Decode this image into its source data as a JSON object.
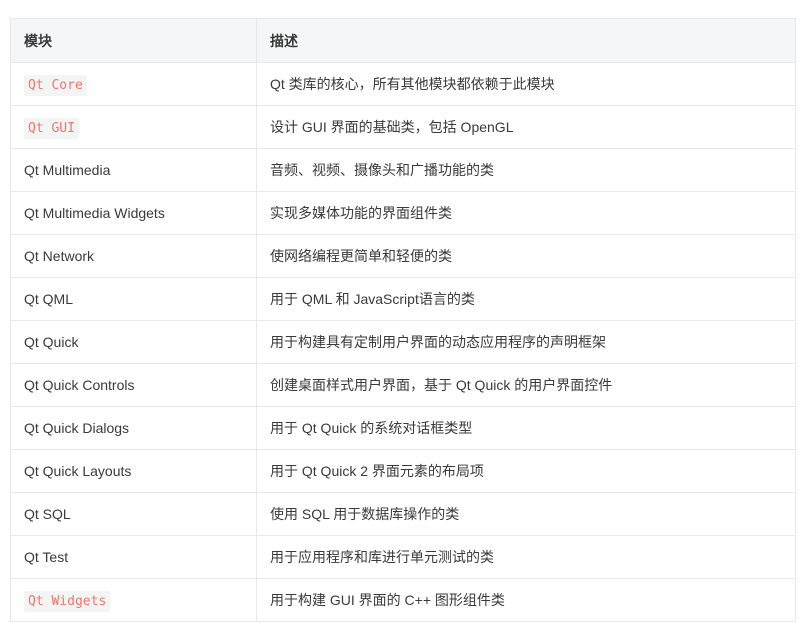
{
  "headers": [
    "模块",
    "描述"
  ],
  "rows": [
    {
      "module": "Qt Core",
      "code": true,
      "desc": "Qt 类库的核心，所有其他模块都依赖于此模块"
    },
    {
      "module": "Qt GUI",
      "code": true,
      "desc": "设计 GUI 界面的基础类，包括 OpenGL"
    },
    {
      "module": "Qt Multimedia",
      "code": false,
      "desc": "音频、视频、摄像头和广播功能的类"
    },
    {
      "module": "Qt Multimedia Widgets",
      "code": false,
      "desc": "实现多媒体功能的界面组件类"
    },
    {
      "module": "Qt Network",
      "code": false,
      "desc": "使网络编程更简单和轻便的类"
    },
    {
      "module": "Qt QML",
      "code": false,
      "desc": "用于 QML 和 JavaScript语言的类"
    },
    {
      "module": "Qt Quick",
      "code": false,
      "desc": "用于构建具有定制用户界面的动态应用程序的声明框架"
    },
    {
      "module": "Qt Quick Controls",
      "code": false,
      "desc": "创建桌面样式用户界面，基于 Qt Quick 的用户界面控件"
    },
    {
      "module": "Qt Quick Dialogs",
      "code": false,
      "desc": "用于 Qt Quick 的系统对话框类型"
    },
    {
      "module": "Qt Quick Layouts",
      "code": false,
      "desc": "用于 Qt Quick 2 界面元素的布局项"
    },
    {
      "module": "Qt SQL",
      "code": false,
      "desc": "使用 SQL 用于数据库操作的类"
    },
    {
      "module": "Qt Test",
      "code": false,
      "desc": "用于应用程序和库进行单元测试的类"
    },
    {
      "module": "Qt Widgets",
      "code": true,
      "desc": "用于构建 GUI 界面的 C++ 图形组件类"
    }
  ],
  "colors": {
    "code_text": "#f4756b",
    "code_bg": "#f3f4f4",
    "header_bg": "#f5f6f7",
    "border": "#e8e8e8"
  }
}
